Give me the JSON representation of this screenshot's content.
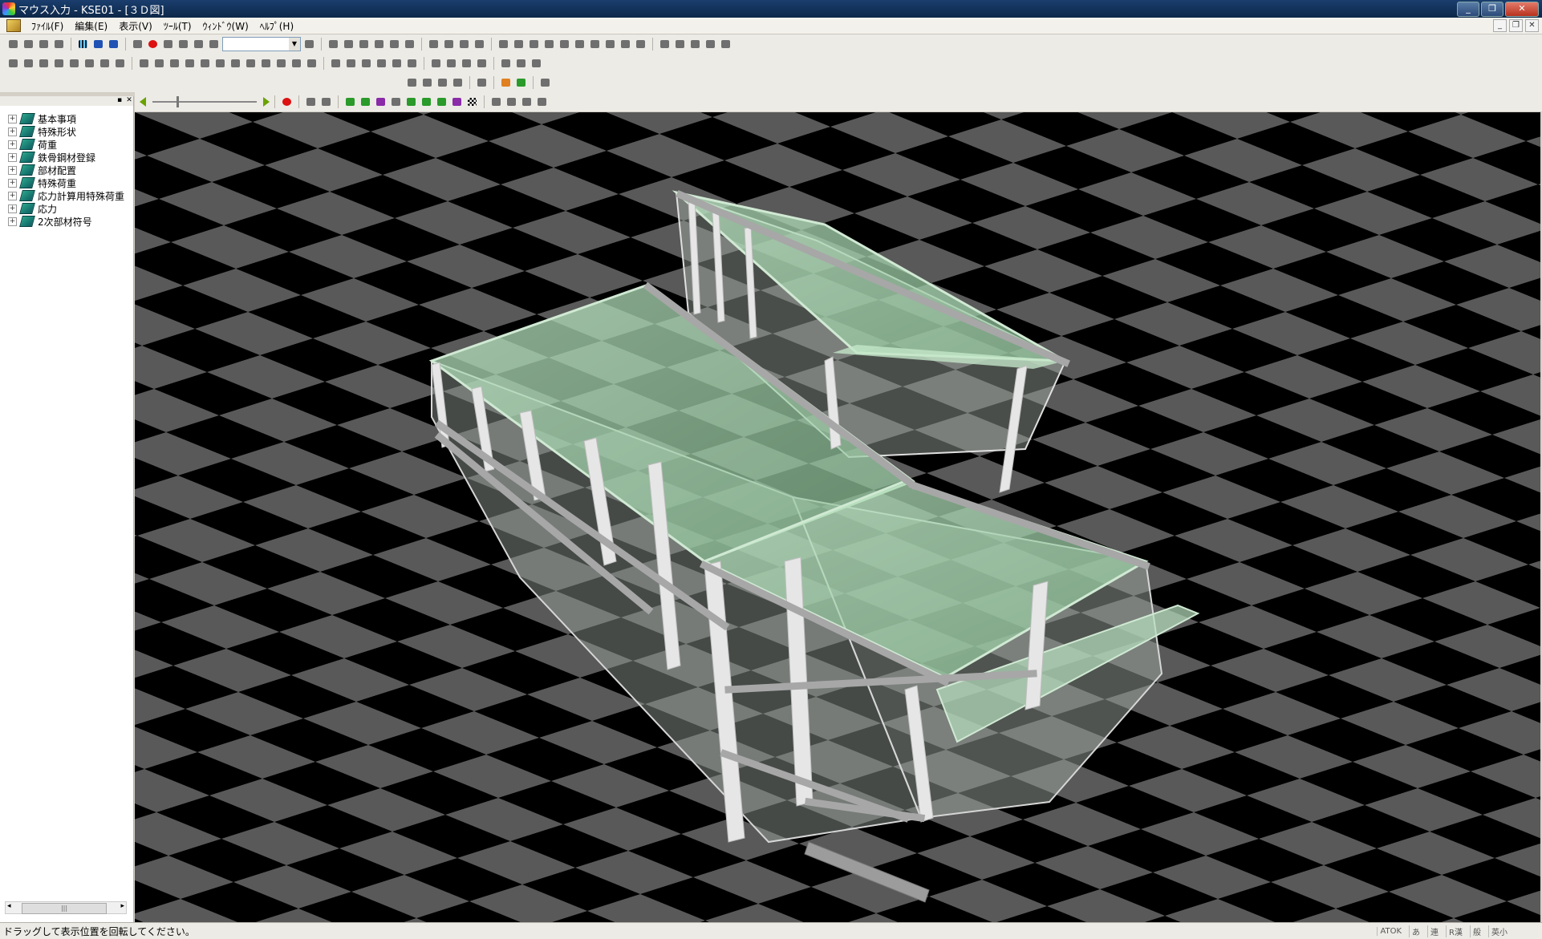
{
  "window": {
    "title": "マウス入力 - KSE01 - [３Ｄ図]",
    "controls": [
      "_",
      "❐",
      "✕"
    ]
  },
  "menu": {
    "items": [
      "ﾌｧｲﾙ(F)",
      "編集(E)",
      "表示(V)",
      "ﾂｰﾙ(T)",
      "ｳｨﾝﾄﾞｳ(W)",
      "ﾍﾙﾌﾟ(H)"
    ],
    "mdi_controls": [
      "_",
      "❐",
      "✕"
    ]
  },
  "toolbar": {
    "combo_value": ""
  },
  "panel": {
    "close": "✕",
    "pin": "▪"
  },
  "tree": {
    "items": [
      {
        "label": "基本事項",
        "expander": "+"
      },
      {
        "label": "特殊形状",
        "expander": "+"
      },
      {
        "label": "荷重",
        "expander": "+"
      },
      {
        "label": "鉄骨鋼材登録",
        "expander": "+"
      },
      {
        "label": "部材配置",
        "expander": "+"
      },
      {
        "label": "特殊荷重",
        "expander": "+"
      },
      {
        "label": "応力計算用特殊荷重",
        "expander": "+"
      },
      {
        "label": "応力",
        "expander": "+"
      },
      {
        "label": "2次部材符号",
        "expander": "+"
      }
    ]
  },
  "scroll": {
    "left": "◂",
    "right": "▸",
    "grip": "|||"
  },
  "status": {
    "message": "ドラッグして表示位置を回転してください。",
    "ime": [
      "ATOK",
      "あ",
      "連",
      "R漢",
      "般",
      "英小"
    ]
  },
  "colors": {
    "titlebar": "#0d2748",
    "floor_dark": "#000000",
    "floor_light": "#595959",
    "frame": "#e8e8e8",
    "slab": "#a8d8b0"
  }
}
